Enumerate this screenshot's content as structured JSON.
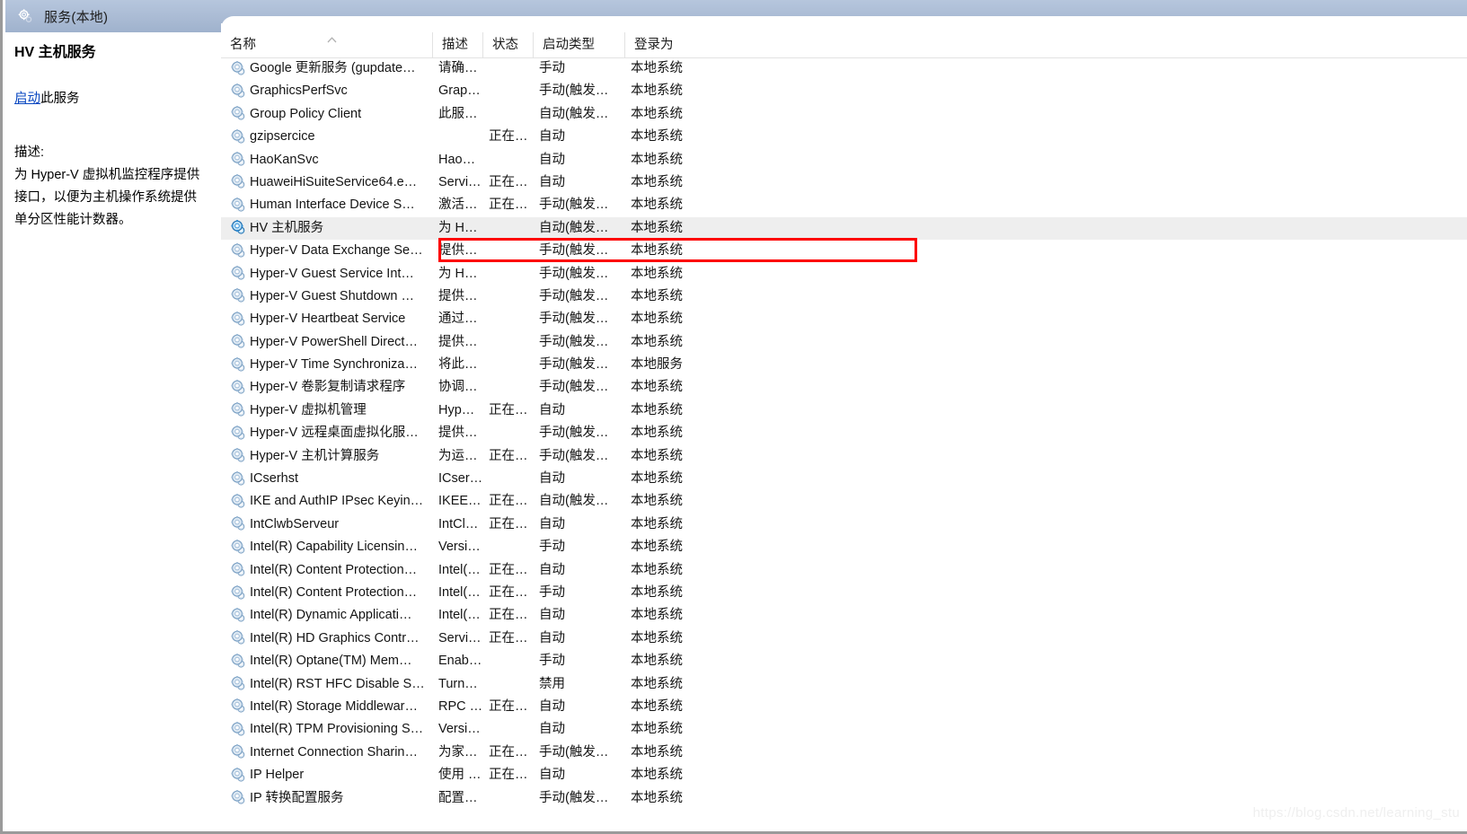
{
  "window": {
    "titlebar": {
      "icon": "services-gear-icon",
      "title": "服务(本地)"
    }
  },
  "details_pane": {
    "service_title": "HV 主机服务",
    "action_link": "启动",
    "action_suffix": "此服务",
    "description_label": "描述:",
    "description_body": "为 Hyper-V 虚拟机监控程序提供接口，以便为主机操作系统提供单分区性能计数器。"
  },
  "list": {
    "columns": [
      {
        "key": "name",
        "label": "名称"
      },
      {
        "key": "desc",
        "label": "描述"
      },
      {
        "key": "status",
        "label": "状态"
      },
      {
        "key": "start",
        "label": "启动类型"
      },
      {
        "key": "logon",
        "label": "登录为"
      }
    ],
    "sort_indicator": "▲",
    "sort_column": "名称",
    "selected_row_index": 7,
    "annotation": {
      "color": "#fd0000",
      "target": "HV 主机服务"
    },
    "rows": [
      {
        "name": "Google 更新服务 (gupdate…",
        "desc": "请确…",
        "status": "",
        "start": "手动",
        "logon": "本地系统"
      },
      {
        "name": "GraphicsPerfSvc",
        "desc": "Grap…",
        "status": "",
        "start": "手动(触发…",
        "logon": "本地系统"
      },
      {
        "name": "Group Policy Client",
        "desc": "此服…",
        "status": "",
        "start": "自动(触发…",
        "logon": "本地系统"
      },
      {
        "name": "gzipsercice",
        "desc": "",
        "status": "正在…",
        "start": "自动",
        "logon": "本地系统"
      },
      {
        "name": "HaoKanSvc",
        "desc": "Hao…",
        "status": "",
        "start": "自动",
        "logon": "本地系统"
      },
      {
        "name": "HuaweiHiSuiteService64.e…",
        "desc": "Servi…",
        "status": "正在…",
        "start": "自动",
        "logon": "本地系统"
      },
      {
        "name": "Human Interface Device S…",
        "desc": "激活…",
        "status": "正在…",
        "start": "手动(触发…",
        "logon": "本地系统"
      },
      {
        "name": "HV 主机服务",
        "desc": "为 H…",
        "status": "",
        "start": "自动(触发…",
        "logon": "本地系统"
      },
      {
        "name": "Hyper-V Data Exchange Se…",
        "desc": "提供…",
        "status": "",
        "start": "手动(触发…",
        "logon": "本地系统"
      },
      {
        "name": "Hyper-V Guest Service Int…",
        "desc": "为 H…",
        "status": "",
        "start": "手动(触发…",
        "logon": "本地系统"
      },
      {
        "name": "Hyper-V Guest Shutdown …",
        "desc": "提供…",
        "status": "",
        "start": "手动(触发…",
        "logon": "本地系统"
      },
      {
        "name": "Hyper-V Heartbeat Service",
        "desc": "通过…",
        "status": "",
        "start": "手动(触发…",
        "logon": "本地系统"
      },
      {
        "name": "Hyper-V PowerShell Direct…",
        "desc": "提供…",
        "status": "",
        "start": "手动(触发…",
        "logon": "本地系统"
      },
      {
        "name": "Hyper-V Time Synchroniza…",
        "desc": "将此…",
        "status": "",
        "start": "手动(触发…",
        "logon": "本地服务"
      },
      {
        "name": "Hyper-V 卷影复制请求程序",
        "desc": "协调…",
        "status": "",
        "start": "手动(触发…",
        "logon": "本地系统"
      },
      {
        "name": "Hyper-V 虚拟机管理",
        "desc": "Hyp…",
        "status": "正在…",
        "start": "自动",
        "logon": "本地系统"
      },
      {
        "name": "Hyper-V 远程桌面虚拟化服…",
        "desc": "提供…",
        "status": "",
        "start": "手动(触发…",
        "logon": "本地系统"
      },
      {
        "name": "Hyper-V 主机计算服务",
        "desc": "为运…",
        "status": "正在…",
        "start": "手动(触发…",
        "logon": "本地系统"
      },
      {
        "name": "ICserhst",
        "desc": "ICser…",
        "status": "",
        "start": "自动",
        "logon": "本地系统"
      },
      {
        "name": "IKE and AuthIP IPsec Keyin…",
        "desc": "IKEE…",
        "status": "正在…",
        "start": "自动(触发…",
        "logon": "本地系统"
      },
      {
        "name": "IntClwbServeur",
        "desc": "IntCl…",
        "status": "正在…",
        "start": "自动",
        "logon": "本地系统"
      },
      {
        "name": "Intel(R) Capability Licensin…",
        "desc": "Versi…",
        "status": "",
        "start": "手动",
        "logon": "本地系统"
      },
      {
        "name": "Intel(R) Content Protection…",
        "desc": "Intel(…",
        "status": "正在…",
        "start": "自动",
        "logon": "本地系统"
      },
      {
        "name": "Intel(R) Content Protection…",
        "desc": "Intel(…",
        "status": "正在…",
        "start": "手动",
        "logon": "本地系统"
      },
      {
        "name": "Intel(R) Dynamic Applicati…",
        "desc": "Intel(…",
        "status": "正在…",
        "start": "自动",
        "logon": "本地系统"
      },
      {
        "name": "Intel(R) HD Graphics Contr…",
        "desc": "Servi…",
        "status": "正在…",
        "start": "自动",
        "logon": "本地系统"
      },
      {
        "name": "Intel(R) Optane(TM) Mem…",
        "desc": "Enab…",
        "status": "",
        "start": "手动",
        "logon": "本地系统"
      },
      {
        "name": "Intel(R) RST HFC Disable S…",
        "desc": "Turn…",
        "status": "",
        "start": "禁用",
        "logon": "本地系统"
      },
      {
        "name": "Intel(R) Storage Middlewar…",
        "desc": "RPC …",
        "status": "正在…",
        "start": "自动",
        "logon": "本地系统"
      },
      {
        "name": "Intel(R) TPM Provisioning S…",
        "desc": "Versi…",
        "status": "",
        "start": "自动",
        "logon": "本地系统"
      },
      {
        "name": "Internet Connection Sharin…",
        "desc": "为家…",
        "status": "正在…",
        "start": "手动(触发…",
        "logon": "本地系统"
      },
      {
        "name": "IP Helper",
        "desc": "使用 …",
        "status": "正在…",
        "start": "自动",
        "logon": "本地系统"
      },
      {
        "name": "IP 转换配置服务",
        "desc": "配置…",
        "status": "",
        "start": "手动(触发…",
        "logon": "本地系统"
      }
    ]
  },
  "watermark": "https://blog.csdn.net/learning_stu"
}
